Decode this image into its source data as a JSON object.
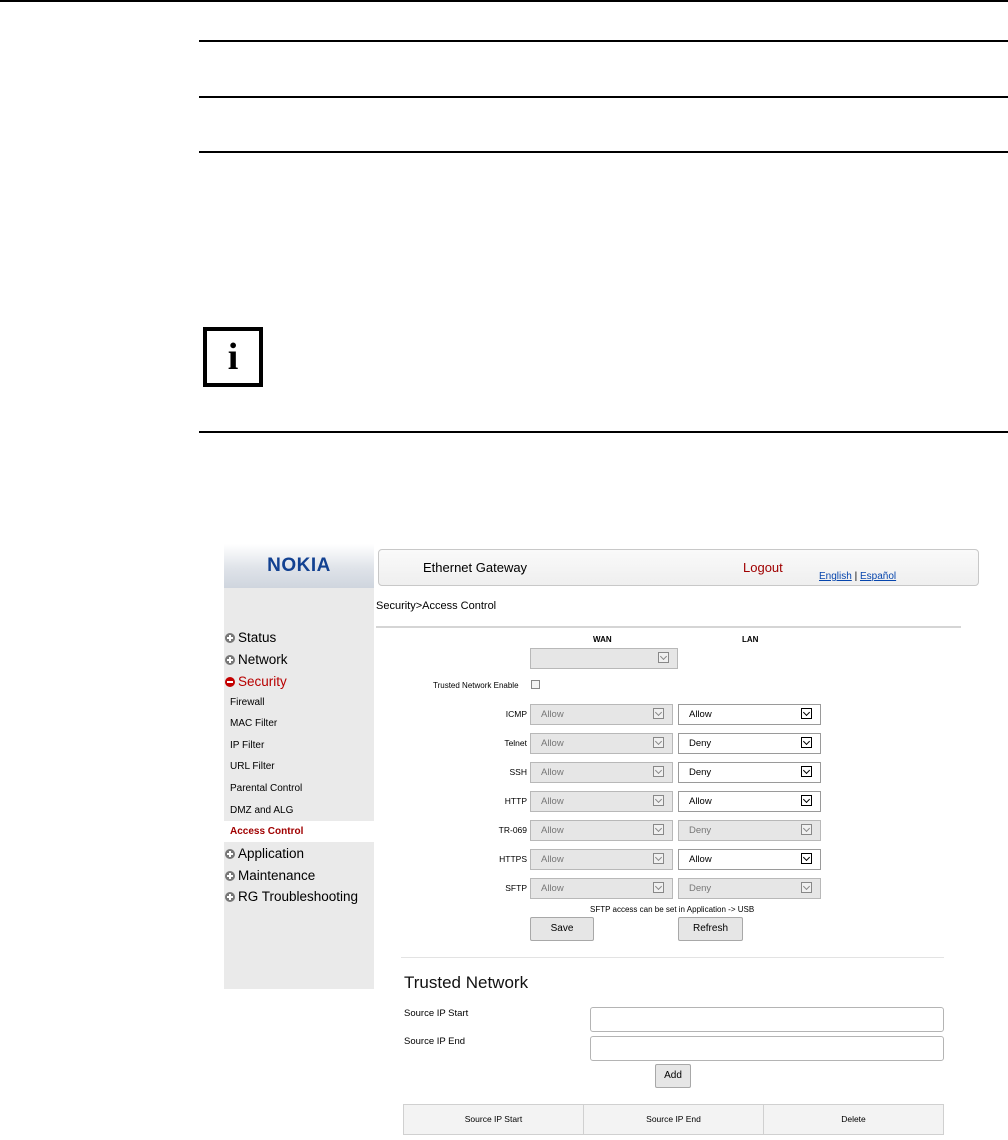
{
  "app": {
    "logo": "NOKIA",
    "title": "Ethernet Gateway",
    "logout": "Logout",
    "lang_en": "English",
    "lang_sep": "|",
    "lang_es": "Español"
  },
  "breadcrumb": "Security>Access Control",
  "nav": {
    "status": "Status",
    "network": "Network",
    "security": "Security",
    "firewall": "Firewall",
    "mac_filter": "MAC Filter",
    "ip_filter": "IP Filter",
    "url_filter": "URL Filter",
    "parental_control": "Parental Control",
    "dmz_alg": "DMZ and ALG",
    "access_control": "Access Control",
    "application": "Application",
    "maintenance": "Maintenance",
    "rg_troubleshooting": "RG Troubleshooting"
  },
  "columns": {
    "wan": "WAN",
    "lan": "LAN"
  },
  "trusted_enable_label": "Trusted Network Enable",
  "trusted_enable_checked": false,
  "rows": [
    {
      "label": "ICMP",
      "wan": "Allow",
      "lan": "Allow",
      "lan_enabled": true
    },
    {
      "label": "Telnet",
      "wan": "Allow",
      "lan": "Deny",
      "lan_enabled": true
    },
    {
      "label": "SSH",
      "wan": "Allow",
      "lan": "Deny",
      "lan_enabled": true
    },
    {
      "label": "HTTP",
      "wan": "Allow",
      "lan": "Allow",
      "lan_enabled": true
    },
    {
      "label": "TR-069",
      "wan": "Allow",
      "lan": "Deny",
      "lan_enabled": false
    },
    {
      "label": "HTTPS",
      "wan": "Allow",
      "lan": "Allow",
      "lan_enabled": true
    },
    {
      "label": "SFTP",
      "wan": "Allow",
      "lan": "Deny",
      "lan_enabled": false
    }
  ],
  "sftp_note": "SFTP access can be set in Application -> USB",
  "buttons": {
    "save": "Save",
    "refresh": "Refresh",
    "add": "Add"
  },
  "trusted": {
    "title": "Trusted Network",
    "start_label": "Source IP Start",
    "end_label": "Source IP End",
    "start_value": "",
    "end_value": ""
  },
  "table": {
    "headers": [
      "Source IP Start",
      "Source IP End",
      "Delete"
    ]
  }
}
